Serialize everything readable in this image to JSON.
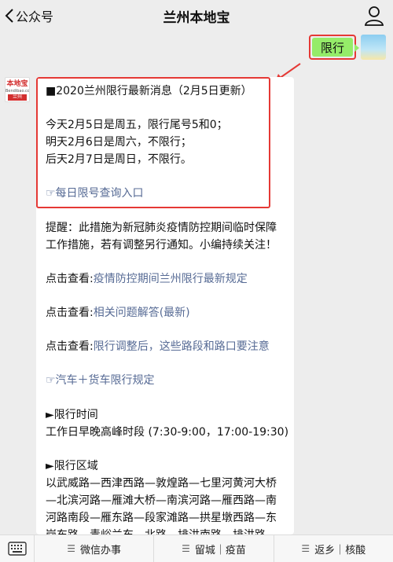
{
  "header": {
    "back_label": "公众号",
    "title": "兰州本地宝"
  },
  "outgoing": {
    "text": "限行"
  },
  "avatar": {
    "line1": "本地宝",
    "line2": "Bendibao.com",
    "line3": "兰州"
  },
  "message": {
    "heading": "■2020兰州限行最新消息（2月5日更新）",
    "today": "今天2月5日是周五，限行尾号5和0；",
    "tomorrow": "明天2月6日是周六，不限行；",
    "after": "后天2月7日是周日，不限行。",
    "query_link": "☞每日限号查询入口",
    "reminder_1": "提醒：此措施为新冠肺炎疫情防控期间临时保障",
    "reminder_2": "工作措施，若有调整另行通知。小编持续关注！",
    "view_prefix": "点击查看:",
    "link_1": "疫情防控期间兰州限行最新规定",
    "link_2": "相关问题解答(最新)",
    "link_3": "限行调整后，这些路段和路口要注意",
    "rules_link": "☞汽车＋货车限行规定",
    "time_title": "►限行时间",
    "time_text": "工作日早晚高峰时段 (7:30-9:00，17:00-19:30)",
    "area_title": "►限行区域",
    "area_1": "以武威路—西津西路—敦煌路—七里河黄河大桥",
    "area_2": "—北滨河路—雁滩大桥—南滨河路—雁西路—南",
    "area_3": "河路南段—雁东路—段家滩路—拱星墩西路—东",
    "area_4": "岗东路—青峪兰东—北路—排洪南路—排洪路"
  },
  "menu": {
    "items": [
      "微信办事",
      "留城｜疫苗",
      "返乡｜核酸"
    ]
  },
  "colors": {
    "highlight": "#e53935",
    "bubble_green": "#95ec69",
    "link": "#576b95"
  }
}
